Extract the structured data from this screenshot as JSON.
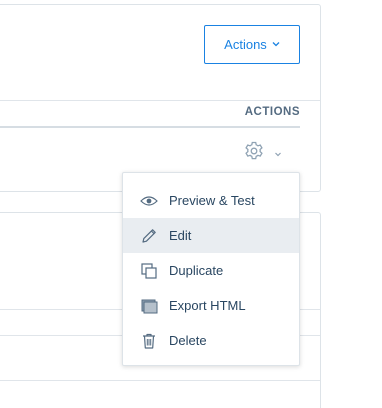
{
  "header": {
    "actions_button_label": "Actions",
    "actions_chevron": "⌄"
  },
  "table": {
    "column_header": "ACTIONS",
    "row_actions": {
      "icon": "gear-icon",
      "chevron": "chevron-down-icon"
    }
  },
  "menu": {
    "items": [
      {
        "label": "Preview & Test",
        "icon": "eye-icon"
      },
      {
        "label": "Edit",
        "icon": "pencil-icon",
        "highlighted": true
      },
      {
        "label": "Duplicate",
        "icon": "duplicate-icon"
      },
      {
        "label": "Export HTML",
        "icon": "export-html-icon"
      },
      {
        "label": "Delete",
        "icon": "trash-icon"
      }
    ]
  },
  "colors": {
    "accent": "#1a82e2",
    "text": "#294661",
    "menu_highlight": "#e9edf1",
    "border": "#dde3e8"
  }
}
